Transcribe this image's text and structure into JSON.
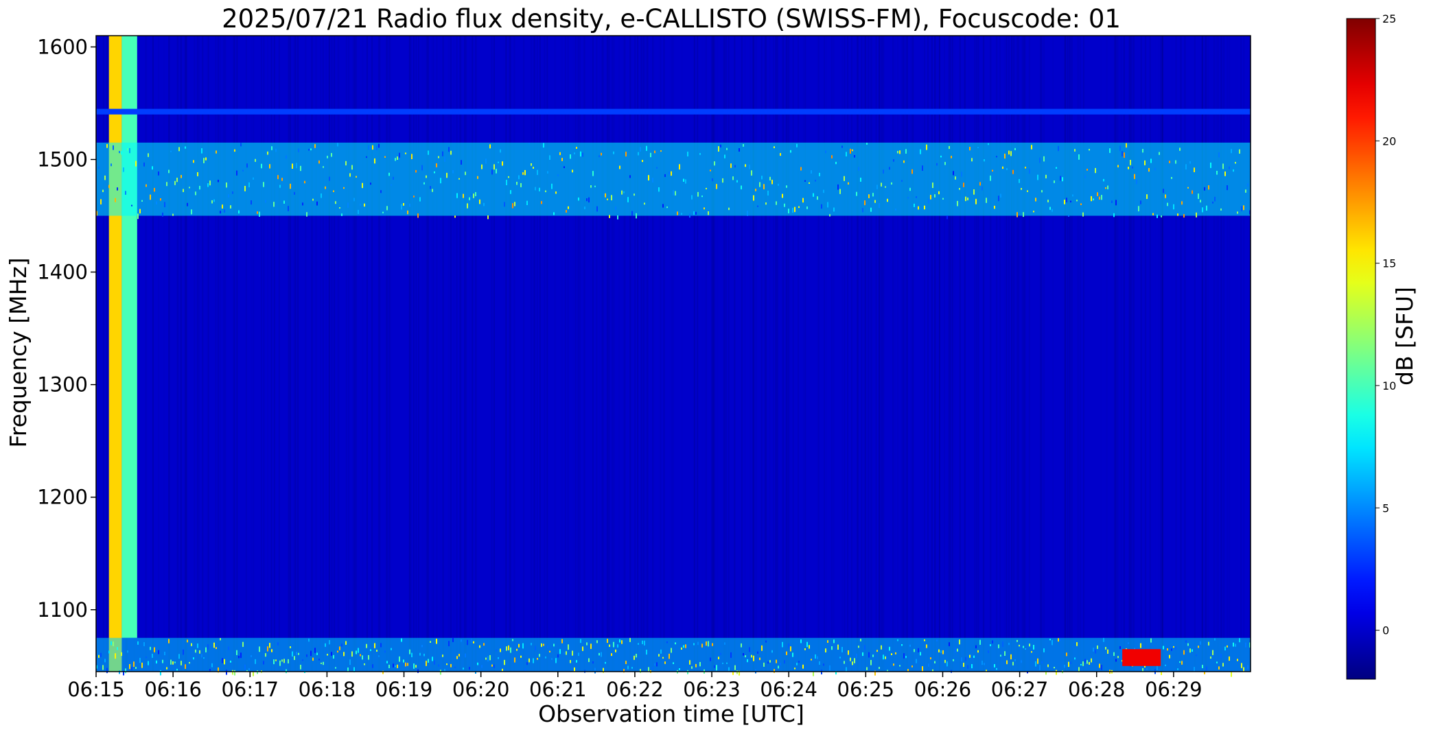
{
  "chart_data": {
    "type": "heatmap",
    "title": "2025/07/21  Radio flux density, e-CALLISTO (SWISS-FM), Focuscode: 01",
    "xlabel": "Observation time [UTC]",
    "ylabel": "Frequency [MHz]",
    "x_ticks": [
      "06:15",
      "06:16",
      "06:17",
      "06:18",
      "06:19",
      "06:20",
      "06:21",
      "06:22",
      "06:23",
      "06:24",
      "06:25",
      "06:26",
      "06:27",
      "06:28",
      "06:29"
    ],
    "xlim": [
      "06:15",
      "06:30"
    ],
    "y_ticks": [
      1100,
      1200,
      1300,
      1400,
      1500,
      1600
    ],
    "ylim": [
      1045,
      1610
    ],
    "colorbar": {
      "label": "dB [SFU]",
      "ticks": [
        0,
        5,
        10,
        15,
        20,
        25
      ],
      "range": [
        -2,
        25
      ],
      "colormap": "jet"
    },
    "background_level_db": 0,
    "features": [
      {
        "name": "calibration band 1",
        "time": [
          "06:15:10",
          "06:15:20"
        ],
        "freq": [
          1045,
          1610
        ],
        "level_db": 16
      },
      {
        "name": "calibration band 2",
        "time": [
          "06:15:20",
          "06:15:32"
        ],
        "freq": [
          1075,
          1610
        ],
        "level_db": 10
      },
      {
        "name": "RFI band upper",
        "time": [
          "06:15",
          "06:30"
        ],
        "freq": [
          1450,
          1515
        ],
        "level_db": 8
      },
      {
        "name": "RFI band lower",
        "time": [
          "06:15",
          "06:30"
        ],
        "freq": [
          1045,
          1075
        ],
        "level_db": 7
      },
      {
        "name": "faint line",
        "time": [
          "06:15",
          "06:30"
        ],
        "freq": [
          1540,
          1545
        ],
        "level_db": 3
      },
      {
        "name": "burst",
        "time": [
          "06:28:20",
          "06:28:50"
        ],
        "freq": [
          1050,
          1065
        ],
        "level_db": 22
      }
    ]
  }
}
